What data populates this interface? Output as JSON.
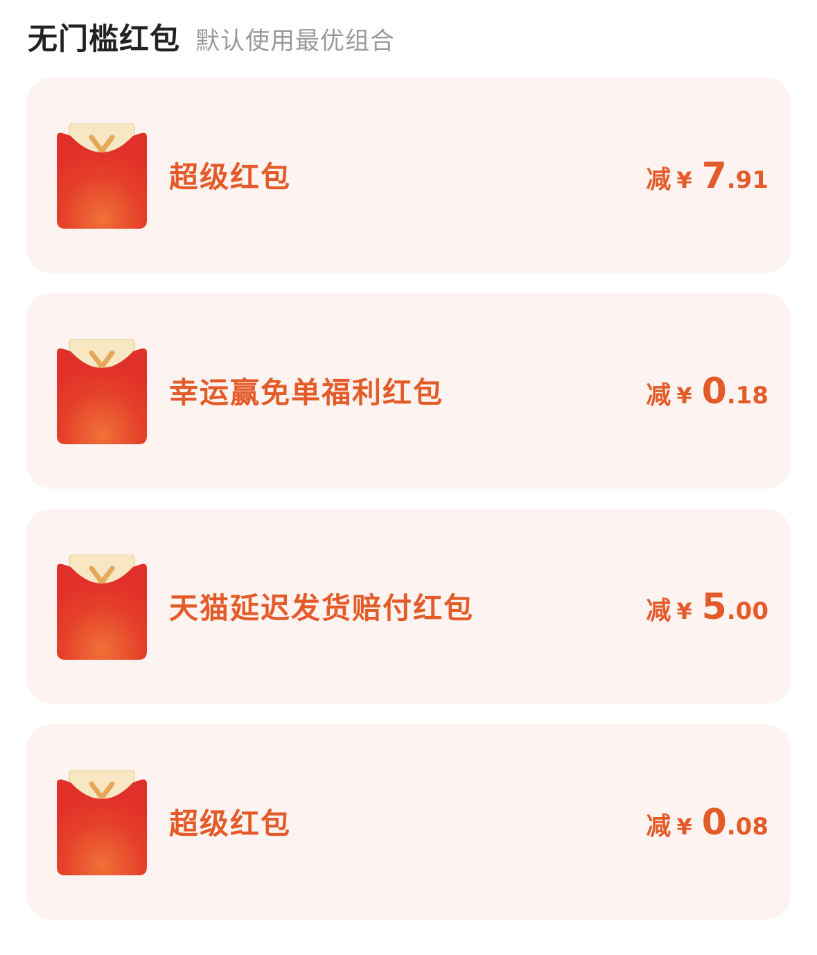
{
  "header": {
    "title": "无门槛红包",
    "subtitle": "默认使用最优组合"
  },
  "colors": {
    "accent": "#e45b2a",
    "card_bg": "#fdf4f1",
    "envelope_red": "#e5352a"
  },
  "icon": "red-envelope-icon",
  "coupons": [
    {
      "name": "超级红包",
      "prefix": "减",
      "currency": "¥",
      "amount_int": "7",
      "amount_dec": ".91"
    },
    {
      "name": "幸运赢免单福利红包",
      "prefix": "减",
      "currency": "¥",
      "amount_int": "0",
      "amount_dec": ".18"
    },
    {
      "name": "天猫延迟发货赔付红包",
      "prefix": "减",
      "currency": "¥",
      "amount_int": "5",
      "amount_dec": ".00"
    },
    {
      "name": "超级红包",
      "prefix": "减",
      "currency": "¥",
      "amount_int": "0",
      "amount_dec": ".08"
    }
  ]
}
